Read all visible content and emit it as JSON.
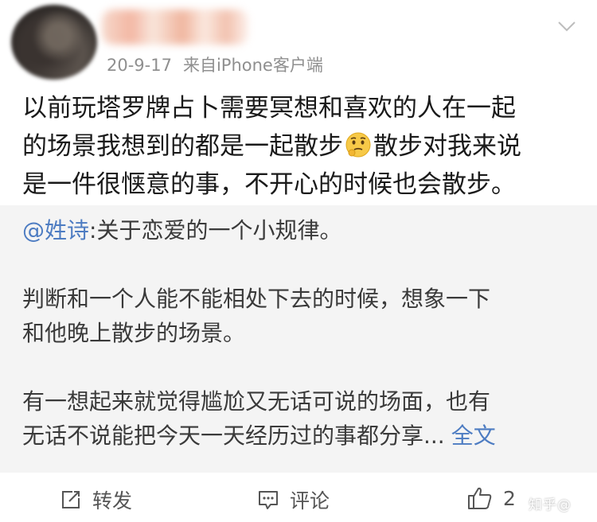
{
  "post": {
    "date": "20-9-17",
    "source": "来自iPhone客户端",
    "content_lines": [
      "以前玩塔罗牌占卜需要冥想和喜欢的人在一起",
      "的场景我想到的都是一起散步",
      "散步对我来说",
      "是一件很惬意的事，不开心的时候也会散步。"
    ],
    "emoji_name": "thinking-face-emoji"
  },
  "quote": {
    "mention": "@姓诗",
    "line1_rest": ":关于恋爱的一个小规律。",
    "line2": "判断和一个人能不能相处下去的时候，想象一下",
    "line3": "和他晚上散步的场景。",
    "line4": "有一想起来就觉得尴尬又无话可说的场面，也有",
    "line5": "无话不说能把今天一天经历过的事都分享...",
    "full_text_link": "全文"
  },
  "actions": {
    "repost_label": "转发",
    "comment_label": "评论",
    "like_count": "2"
  },
  "watermark": "知乎@"
}
